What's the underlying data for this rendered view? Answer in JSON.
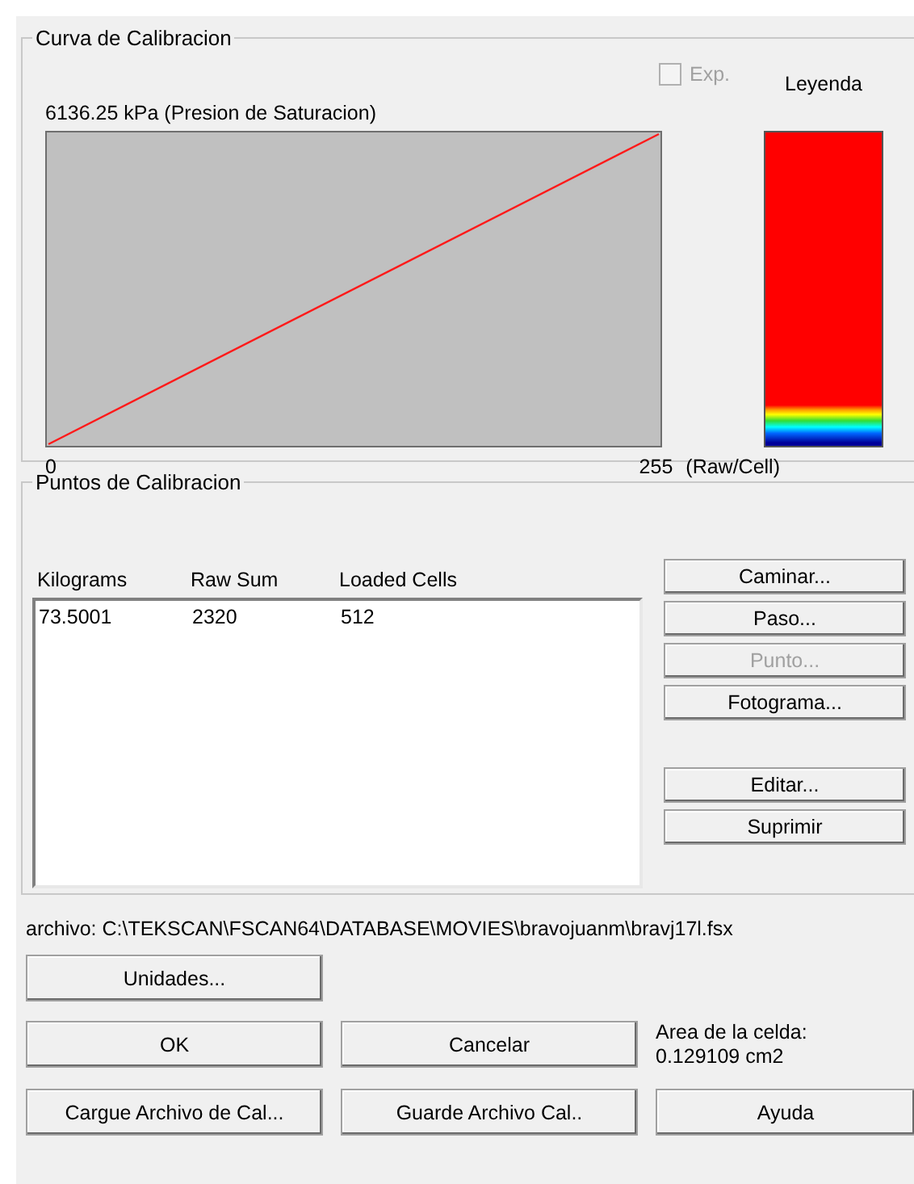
{
  "curve_group": {
    "title": "Curva de Calibracion",
    "exp_checkbox": {
      "label": "Exp.",
      "checked": false,
      "disabled": true
    },
    "legend_title": "Leyenda",
    "y_max_label": "6136.25 kPa (Presion de Saturacion)",
    "x_min_label": "0",
    "x_max_label": "255",
    "x_unit_label": "(Raw/Cell)"
  },
  "points_group": {
    "title": "Puntos de Calibracion",
    "columns": [
      "Kilograms",
      "Raw Sum",
      "Loaded Cells"
    ],
    "rows": [
      [
        "73.5001",
        "2320",
        "512"
      ]
    ],
    "button_groups": [
      [
        {
          "label": "Caminar...",
          "disabled": false
        },
        {
          "label": "Paso...",
          "disabled": false
        },
        {
          "label": "Punto...",
          "disabled": true
        },
        {
          "label": "Fotograma...",
          "disabled": false
        }
      ],
      [
        {
          "label": "Editar...",
          "disabled": false
        },
        {
          "label": "Suprimir",
          "disabled": false
        }
      ]
    ]
  },
  "file_path": "archivo: C:\\TEKSCAN\\FSCAN64\\DATABASE\\MOVIES\\bravojuanm\\bravj17l.fsx",
  "units_button": "Unidades...",
  "ok_button": "OK",
  "cancel_button": "Cancelar",
  "cell_area_label": "Area de la celda:",
  "cell_area_value": "0.129109 cm2",
  "load_button": "Cargue Archivo de Cal...",
  "save_button": "Guarde Archivo Cal..",
  "help_button": "Ayuda"
}
